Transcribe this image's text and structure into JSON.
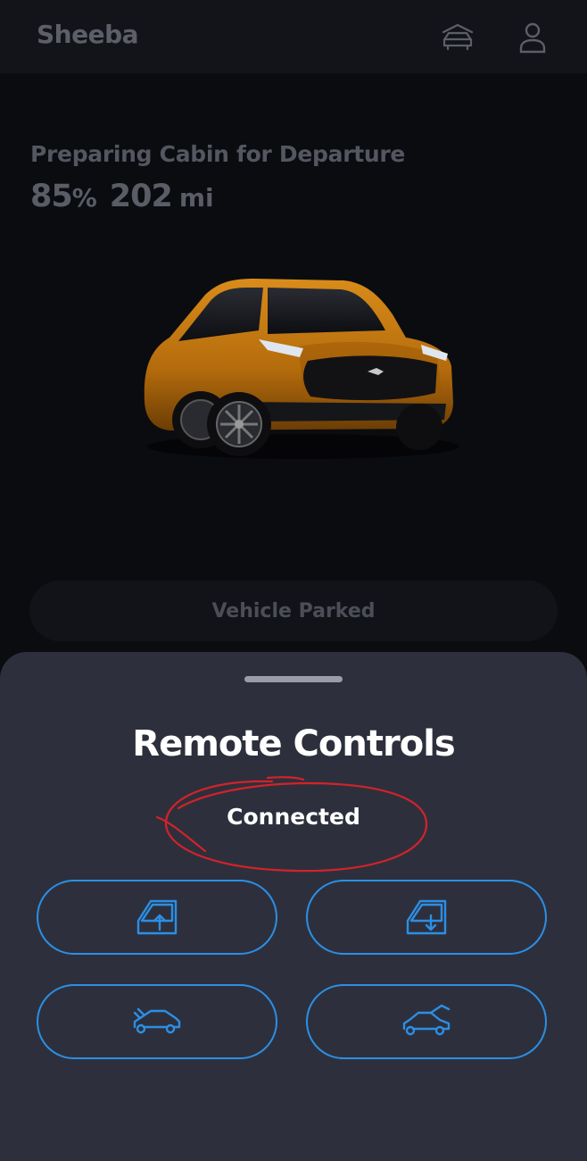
{
  "header": {
    "vehicle_name": "Sheeba",
    "icons": [
      "garage-car-icon",
      "profile-icon"
    ]
  },
  "status": {
    "title": "Preparing Cabin for Departure",
    "charge_percent": "85",
    "charge_unit": "%",
    "range_value": "202",
    "range_unit": "mi"
  },
  "vehicle": {
    "image": "orange-suv",
    "body_color": "#c67a10",
    "state_label": "Vehicle Parked"
  },
  "sheet": {
    "title": "Remote Controls",
    "connection_status": "Connected",
    "annotation_color": "#d4222a",
    "accent_color": "#2b8fe6",
    "buttons": [
      {
        "icon": "window-up-icon"
      },
      {
        "icon": "window-down-icon"
      },
      {
        "icon": "trunk-close-icon"
      },
      {
        "icon": "trunk-open-icon"
      }
    ]
  }
}
